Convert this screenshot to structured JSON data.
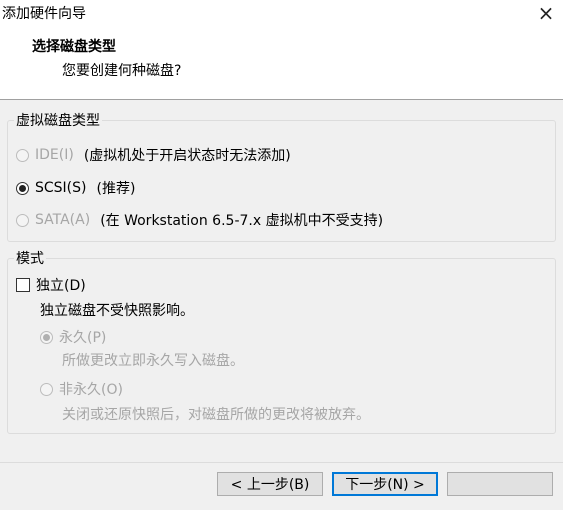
{
  "window": {
    "title": "添加硬件向导",
    "close_label": "×"
  },
  "header": {
    "title": "选择磁盘类型",
    "subtitle": "您要创建何种磁盘?"
  },
  "disk_type": {
    "legend": "虚拟磁盘类型",
    "options": [
      {
        "label": "IDE(I)",
        "note": "(虚拟机处于开启状态时无法添加)",
        "selected": false,
        "disabled": true
      },
      {
        "label": "SCSI(S)",
        "note": "(推荐)",
        "selected": true,
        "disabled": false
      },
      {
        "label": "SATA(A)",
        "note": "(在 Workstation 6.5-7.x 虚拟机中不受支持)",
        "selected": false,
        "disabled": true
      }
    ]
  },
  "mode": {
    "legend": "模式",
    "independent_label": "独立(D)",
    "independent_desc": "独立磁盘不受快照影响。",
    "persistent_label": "永久(P)",
    "persistent_desc": "所做更改立即永久写入磁盘。",
    "nonpersistent_label": "非永久(O)",
    "nonpersistent_desc": "关闭或还原快照后，对磁盘所做的更改将被放弃。"
  },
  "buttons": {
    "back": "< 上一步(B)",
    "next": "下一步(N) >"
  }
}
